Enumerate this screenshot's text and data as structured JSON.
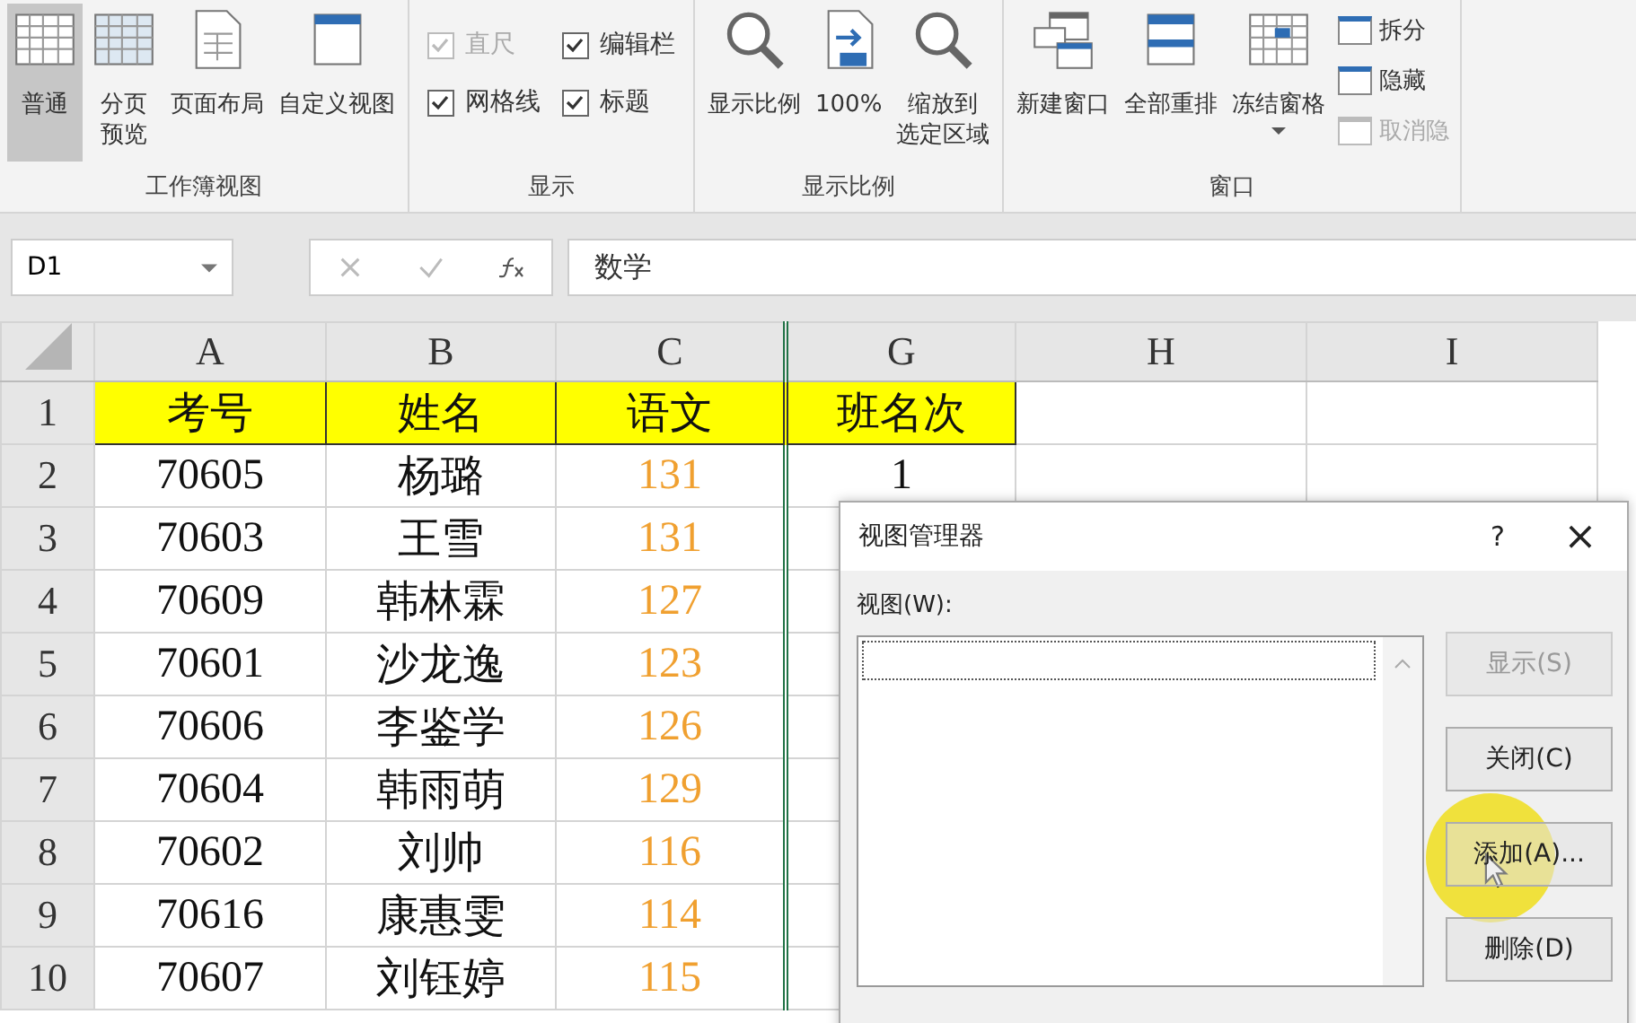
{
  "ribbon": {
    "groups": [
      {
        "label": "工作簿视图",
        "items": [
          {
            "kind": "large",
            "label": "普通",
            "selected": true
          },
          {
            "kind": "large",
            "lines": [
              "分页",
              "预览"
            ],
            "selected": false
          },
          {
            "kind": "large",
            "label": "页面布局",
            "selected": false
          },
          {
            "kind": "large",
            "label": "自定义视图",
            "selected": false
          }
        ]
      },
      {
        "label": "显示",
        "items": [
          {
            "kind": "check",
            "label": "直尺",
            "checked": true,
            "disabled": true
          },
          {
            "kind": "check",
            "label": "编辑栏",
            "checked": true,
            "disabled": false
          },
          {
            "kind": "check",
            "label": "网格线",
            "checked": true,
            "disabled": false
          },
          {
            "kind": "check",
            "label": "标题",
            "checked": true,
            "disabled": false
          }
        ]
      },
      {
        "label": "显示比例",
        "items": [
          {
            "kind": "large",
            "label": "显示比例",
            "selected": false
          },
          {
            "kind": "large",
            "label": "100%",
            "selected": false
          },
          {
            "kind": "large",
            "lines": [
              "缩放到",
              "选定区域"
            ],
            "selected": false
          }
        ]
      },
      {
        "label": "窗口",
        "items": [
          {
            "kind": "large",
            "label": "新建窗口",
            "selected": false
          },
          {
            "kind": "large",
            "label": "全部重排",
            "selected": false
          },
          {
            "kind": "large",
            "label": "冻结窗格",
            "selected": false,
            "dropdown": true
          },
          {
            "kind": "small",
            "label": "拆分",
            "disabled": false
          },
          {
            "kind": "small",
            "label": "隐藏",
            "disabled": false
          },
          {
            "kind": "small",
            "label": "取消隐",
            "disabled": true
          }
        ]
      }
    ]
  },
  "name_box": "D1",
  "formula": "数学",
  "columns": [
    "A",
    "B",
    "C",
    "G",
    "H",
    "I"
  ],
  "rows": [
    {
      "num": "1",
      "cells": [
        "考号",
        "姓名",
        "语文",
        "班名次"
      ],
      "header": true
    },
    {
      "num": "2",
      "cells": [
        "70605",
        "杨璐",
        "131",
        "1"
      ]
    },
    {
      "num": "3",
      "cells": [
        "70603",
        "王雪",
        "131",
        ""
      ]
    },
    {
      "num": "4",
      "cells": [
        "70609",
        "韩林霖",
        "127",
        ""
      ]
    },
    {
      "num": "5",
      "cells": [
        "70601",
        "沙龙逸",
        "123",
        ""
      ]
    },
    {
      "num": "6",
      "cells": [
        "70606",
        "李鉴学",
        "126",
        ""
      ]
    },
    {
      "num": "7",
      "cells": [
        "70604",
        "韩雨萌",
        "129",
        ""
      ]
    },
    {
      "num": "8",
      "cells": [
        "70602",
        "刘帅",
        "116",
        ""
      ]
    },
    {
      "num": "9",
      "cells": [
        "70616",
        "康惠雯",
        "114",
        ""
      ]
    },
    {
      "num": "10",
      "cells": [
        "70607",
        "刘钰婷",
        "115",
        ""
      ]
    }
  ],
  "dialog": {
    "title": "视图管理器",
    "help": "?",
    "close": "×",
    "list_label": "视图(W):",
    "buttons": [
      {
        "label": "显示(S)",
        "disabled": true
      },
      {
        "label": "关闭(C)",
        "disabled": false
      },
      {
        "label": "添加(A)...",
        "disabled": false
      },
      {
        "label": "删除(D)",
        "disabled": false
      }
    ]
  }
}
